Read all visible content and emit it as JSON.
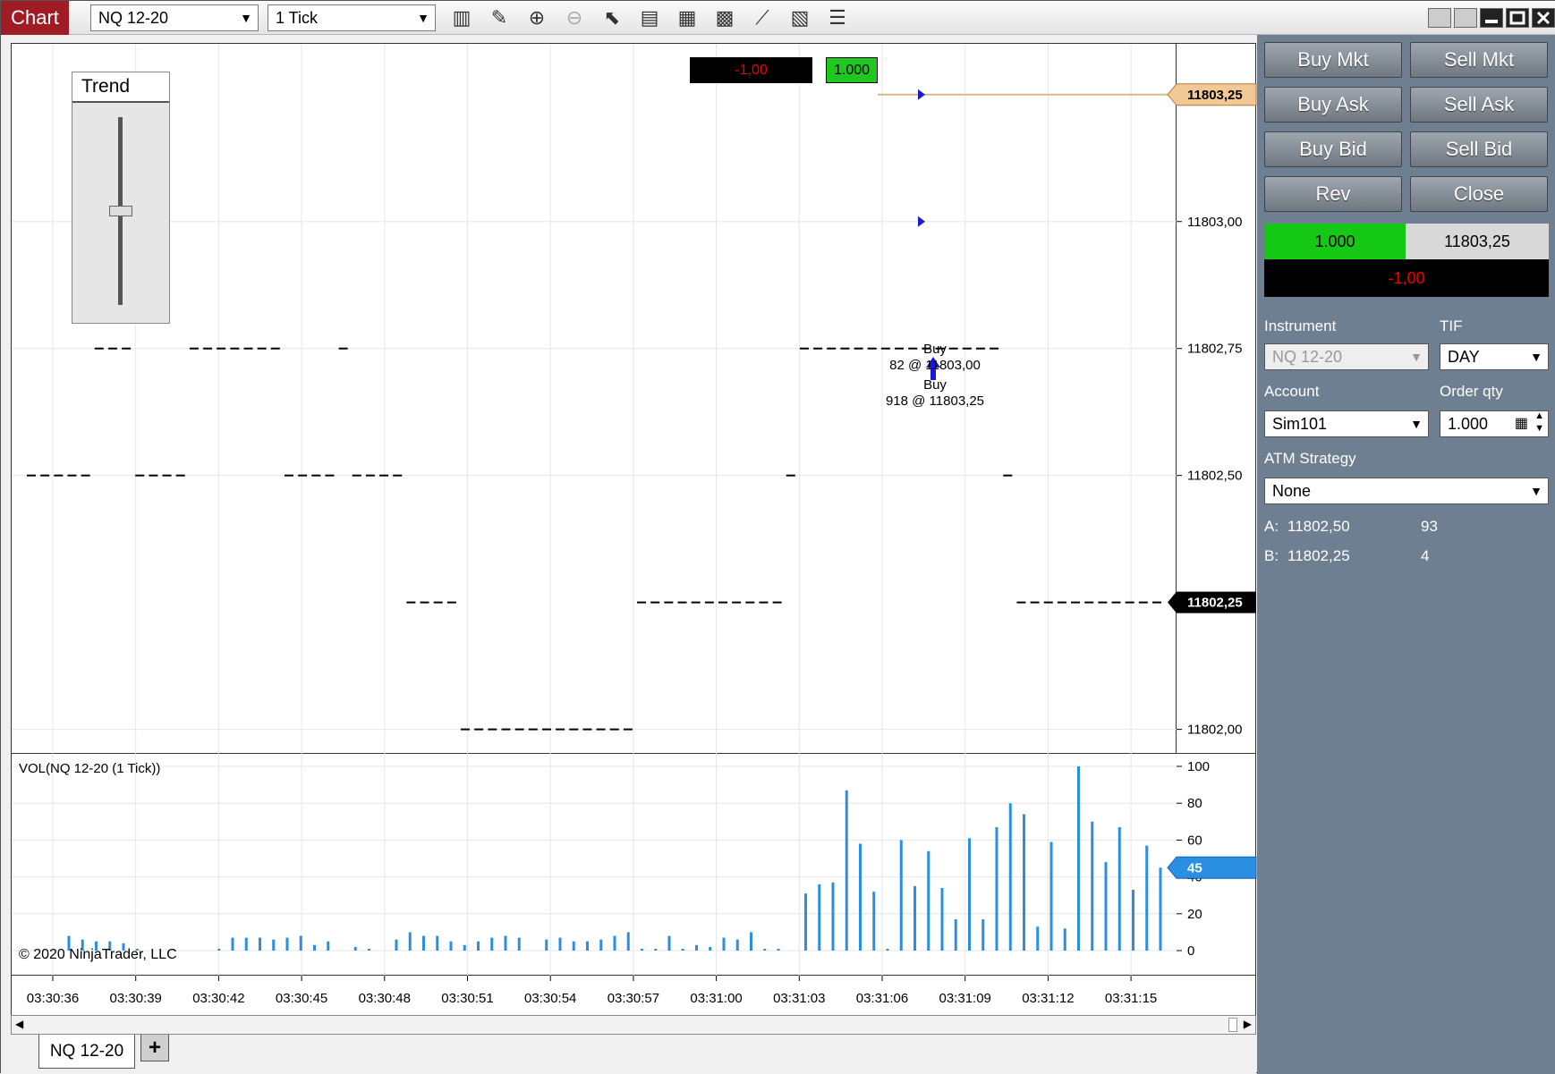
{
  "window": {
    "tab_label": "Chart",
    "instrument_select": "NQ 12-20",
    "interval_select": "1 Tick"
  },
  "toolbar_icons": [
    "bar-type-icon",
    "drawing-tool-icon",
    "zoom-in-icon",
    "zoom-out-icon",
    "pointer-icon",
    "data-box-icon",
    "chart-trader-icon",
    "indicators-icon",
    "strategies-icon",
    "properties-icon",
    "templates-icon"
  ],
  "trend_widget": {
    "title": "Trend",
    "level": 0.5
  },
  "price_axis": {
    "labels": [
      "11803,00",
      "11802,75",
      "11802,50",
      "11802,00"
    ],
    "ymin": 11801.95,
    "ymax": 11803.35
  },
  "position_marker": {
    "pnl": "-1,00",
    "qty": "1.000",
    "price": "11803,25"
  },
  "last_price": "11802,25",
  "execution": {
    "label1": "Buy",
    "text1": "82 @ 11803,00",
    "label2": "Buy",
    "text2": "918 @ 11803,25"
  },
  "volume_panel": {
    "label": "VOL(NQ 12-20 (1 Tick))",
    "axis_labels": [
      "100",
      "80",
      "60",
      "40",
      "20",
      "0"
    ],
    "current": "45",
    "copyright": "© 2020 NinjaTrader, LLC"
  },
  "time_axis": {
    "labels": [
      "03:30:36",
      "03:30:39",
      "03:30:42",
      "03:30:45",
      "03:30:48",
      "03:30:51",
      "03:30:54",
      "03:30:57",
      "03:31:00",
      "03:31:03",
      "03:31:06",
      "03:31:09",
      "03:31:12",
      "03:31:15"
    ]
  },
  "chart_data": {
    "type": "line",
    "title": "",
    "series": [
      {
        "values": [
          11802.5,
          11802.5,
          11802.5,
          11802.5,
          11802.5,
          11802.75,
          11802.75,
          11802.75,
          11802.5,
          11802.5,
          11802.5,
          11802.5,
          11802.75,
          11802.75,
          11802.75,
          11802.75,
          11802.75,
          11802.75,
          11802.75,
          11802.5,
          11802.5,
          11802.5,
          11802.5,
          11802.75,
          11802.5,
          11802.5,
          11802.5,
          11802.5,
          11802.25,
          11802.25,
          11802.25,
          11802.25,
          11802,
          11802,
          11802,
          11802,
          11802,
          11802,
          11802,
          11802,
          11802,
          11802,
          11802,
          11802,
          11802,
          11802.25,
          11802.25,
          11802.25,
          11802.25,
          11802.25,
          11802.25,
          11802.25,
          11802.25,
          11802.25,
          11802.25,
          11802.25,
          11802.5,
          11802.75,
          11802.75,
          11802.75,
          11802.75,
          11802.75,
          11802.75,
          11802.75,
          11802.75,
          11802.75,
          11802.75,
          11802.75,
          11802.75,
          11802.75,
          11802.75,
          11802.75,
          11802.5,
          11802.25,
          11802.25,
          11802.25,
          11802.25,
          11802.25,
          11802.25,
          11802.25,
          11802.25,
          11802.25,
          11802.25,
          11802.25
        ]
      },
      {
        "values": [
          8,
          6,
          5,
          5,
          4,
          1,
          0,
          0,
          0,
          0,
          0,
          1,
          7,
          7,
          7,
          6,
          7,
          8,
          3,
          5,
          0,
          2,
          1,
          0,
          6,
          10,
          8,
          8,
          5,
          3,
          5,
          7,
          8,
          7,
          0,
          6,
          7,
          5,
          5,
          6,
          8,
          10,
          1,
          1,
          8,
          1,
          3,
          2,
          7,
          6,
          10,
          1,
          1,
          0,
          31,
          36,
          37,
          87,
          58,
          32,
          1,
          60,
          35,
          54,
          34,
          17,
          61,
          17,
          67,
          80,
          74,
          13,
          59,
          12,
          100,
          70,
          48,
          67,
          33,
          57,
          45
        ]
      }
    ],
    "ylim": [
      11801.95,
      11803.35
    ],
    "volume_ylim": [
      0,
      100
    ]
  },
  "side_panel": {
    "buy_mkt": "Buy Mkt",
    "sell_mkt": "Sell Mkt",
    "buy_ask": "Buy Ask",
    "sell_ask": "Sell Ask",
    "buy_bid": "Buy Bid",
    "sell_bid": "Sell Bid",
    "rev": "Rev",
    "close": "Close",
    "pos_qty": "1.000",
    "pos_price": "11803,25",
    "pnl": "-1,00",
    "instrument_label": "Instrument",
    "instrument_value": "NQ 12-20",
    "tif_label": "TIF",
    "tif_value": "DAY",
    "account_label": "Account",
    "account_value": "Sim101",
    "qty_label": "Order qty",
    "qty_value": "1.000",
    "atm_label": "ATM Strategy",
    "atm_value": "None",
    "ask_label": "A:",
    "ask_price": "11802,50",
    "ask_size": "93",
    "bid_label": "B:",
    "bid_price": "11802,25",
    "bid_size": "4"
  },
  "bottom_tabs": {
    "active": "NQ 12-20",
    "add": "+"
  }
}
